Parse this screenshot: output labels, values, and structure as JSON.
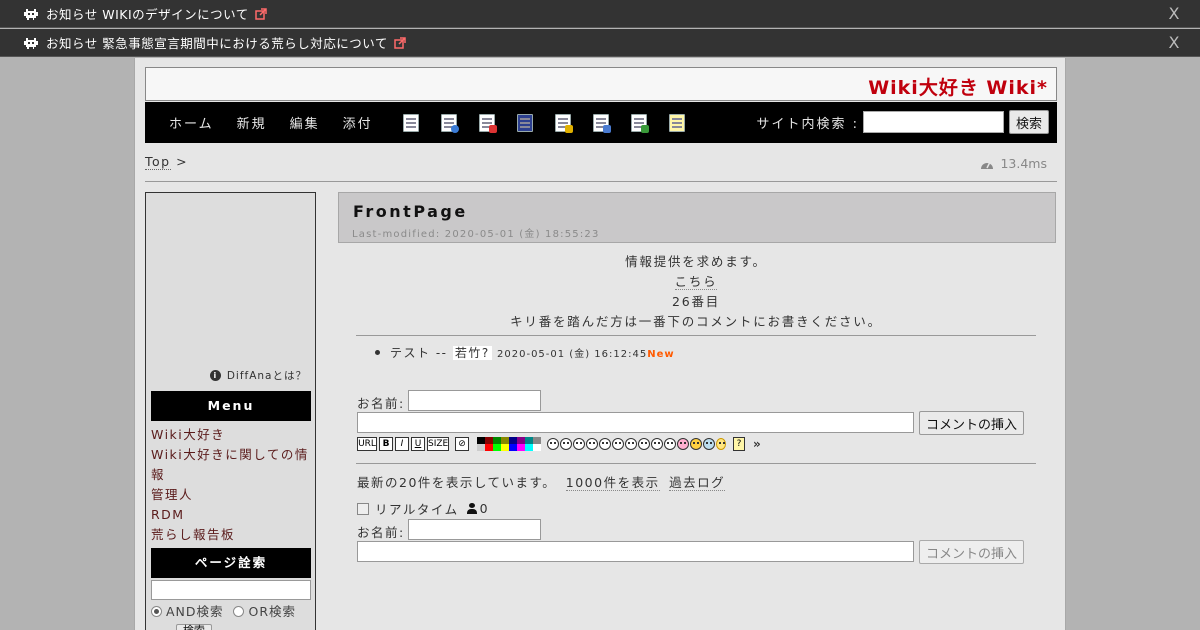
{
  "notices": [
    {
      "text": "お知らせ WIKIのデザインについて",
      "close": "X"
    },
    {
      "text": "お知らせ 緊急事態宣言期間中における荒らし対応について",
      "close": "X"
    }
  ],
  "site": {
    "title": "Wiki大好き Wiki*"
  },
  "nav": {
    "links": [
      "ホーム",
      "新規",
      "編集",
      "添付"
    ],
    "tool_icons": [
      "copy-page-icon",
      "reload-icon",
      "rename-icon",
      "save-icon",
      "lock-icon",
      "list-icon",
      "backup-icon",
      "help-icon"
    ],
    "search_label": "サイト内検索 :",
    "search_button": "検索"
  },
  "breadcrumb": {
    "top": "Top",
    "sep": ">"
  },
  "timing": "13.4ms",
  "sidebar": {
    "diffana": "DiffAnaとは？",
    "menu_title": "Menu",
    "menu_items": [
      "Wiki大好き",
      "Wiki大好きに関しての情報",
      "管理人",
      "RDM",
      "荒らし報告板"
    ],
    "search_title": "ページ詮索",
    "and_label": "AND検索",
    "or_label": "OR検索",
    "search_button": "検索"
  },
  "page": {
    "title": "FrontPage",
    "last_modified": "Last-modified: 2020-05-01 (金) 18:55:23",
    "lines": {
      "l1": "情報提供を求めます。",
      "l2": "こちら",
      "l3": "26番目",
      "l4": "キリ番を踏んだ方は一番下のコメントにお書きください。"
    }
  },
  "comment": {
    "text": "テスト --",
    "author": "若竹?",
    "date": "2020-05-01 (金) 16:12:45",
    "new": "New"
  },
  "form": {
    "name_label": "お名前:",
    "insert_button": "コメントの挿入",
    "format_buttons": [
      "URL",
      "B",
      "I",
      "U",
      "SIZE"
    ],
    "more": "»"
  },
  "log": {
    "info": "最新の20件を表示しています。",
    "show_1000": "1000件を表示",
    "archive": "過去ログ",
    "realtime_label": "リアルタイム",
    "users": "0",
    "name_label": "お名前:",
    "insert_button": "コメントの挿入"
  },
  "colors": {
    "title": "#c0000d",
    "new": "#ff5a00",
    "navbar": "#000000",
    "notice": "#333333"
  }
}
